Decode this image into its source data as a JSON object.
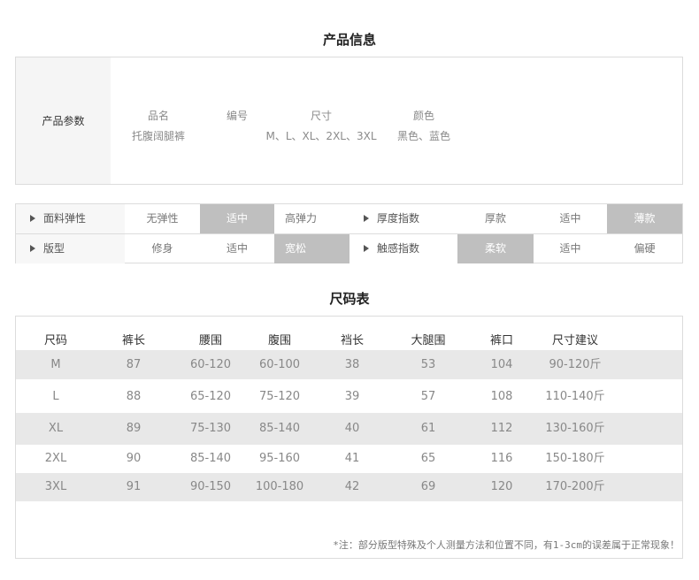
{
  "product_info": {
    "title": "产品信息",
    "section_label": "产品参数",
    "columns": [
      {
        "label": "品名",
        "value": "托腹阔腿裤"
      },
      {
        "label": "编号",
        "value": ""
      },
      {
        "label": "尺寸",
        "value": "M、L、XL、2XL、3XL"
      },
      {
        "label": "颜色",
        "value": "黑色、蓝色"
      }
    ]
  },
  "attributes": {
    "rows": [
      {
        "left": {
          "label": "面料弹性",
          "options": [
            "无弹性",
            "适中",
            "高弹力"
          ],
          "selected": 1
        },
        "right": {
          "label": "厚度指数",
          "options": [
            "厚款",
            "适中",
            "薄款"
          ],
          "selected": 2
        }
      },
      {
        "left": {
          "label": "版型",
          "options": [
            "修身",
            "适中",
            "宽松"
          ],
          "selected": 2
        },
        "right": {
          "label": "触感指数",
          "options": [
            "柔软",
            "适中",
            "偏硬"
          ],
          "selected": 0
        }
      }
    ],
    "selected_color": "#bfbfbf"
  },
  "size_table": {
    "title": "尺码表",
    "headers": [
      "尺码",
      "裤长",
      "腰围",
      "腹围",
      "裆长",
      "大腿围",
      "裤口",
      "尺寸建议"
    ],
    "rows": [
      [
        "M",
        "87",
        "60-120",
        "60-100",
        "38",
        "53",
        "104",
        "90-120斤"
      ],
      [
        "L",
        "88",
        "65-120",
        "75-120",
        "39",
        "57",
        "108",
        "110-140斤"
      ],
      [
        "XL",
        "89",
        "75-130",
        "85-140",
        "40",
        "61",
        "112",
        "130-160斤"
      ],
      [
        "2XL",
        "90",
        "85-140",
        "95-160",
        "41",
        "65",
        "116",
        "150-180斤"
      ],
      [
        "3XL",
        "91",
        "90-150",
        "100-180",
        "42",
        "69",
        "120",
        "170-200斤"
      ]
    ],
    "note": "*注：部分版型特殊及个人测量方法和位置不同，有1-3cm的误差属于正常现象！"
  }
}
